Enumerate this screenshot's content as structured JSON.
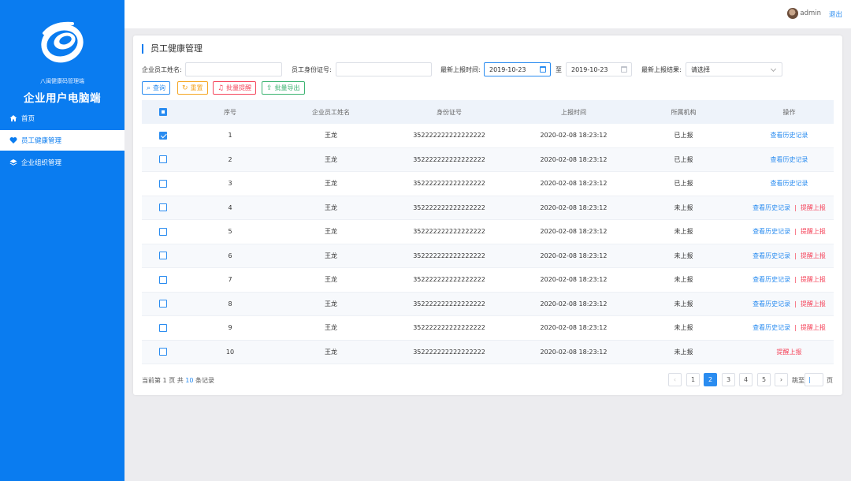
{
  "sidebar": {
    "org_small": "八闽健康码管理端",
    "org_title": "企业用户电脑端",
    "items": [
      {
        "label": "首页",
        "icon": "home-icon"
      },
      {
        "label": "员工健康管理",
        "icon": "heart-icon"
      },
      {
        "label": "企业组织管理",
        "icon": "layers-icon"
      }
    ],
    "active_index": 1
  },
  "topbar": {
    "user": "admin",
    "logout": "退出"
  },
  "page": {
    "title": "员工健康管理"
  },
  "filters": {
    "name_label": "企业员工姓名:",
    "name_value": "",
    "id_label": "员工身份证号:",
    "id_value": "",
    "date_label": "最新上报时间:",
    "date_from": "2019-10-23",
    "date_to_sep": "至",
    "date_to": "2019-10-23",
    "result_label": "最新上报结果:",
    "result_value": "请选择"
  },
  "actions": {
    "search": "查询",
    "reset": "重置",
    "batch_remind": "批量提醒",
    "batch_export": "批量导出"
  },
  "colors": {
    "primary": "#0a7cf0",
    "link": "#2a8cf0",
    "danger": "#f5455b",
    "reset": "#f5a623",
    "export": "#3cb371"
  },
  "table": {
    "columns": [
      "序号",
      "企业员工姓名",
      "身份证号",
      "上报时间",
      "所属机构",
      "操作"
    ],
    "header_checkbox_state": "indeterminate",
    "rows": [
      {
        "no": "1",
        "name": "王龙",
        "id": "352222222222222222",
        "time": "2020-02-08 18:23:12",
        "status": "已上报",
        "checked": true,
        "history": "查看历史记录",
        "remind": ""
      },
      {
        "no": "2",
        "name": "王龙",
        "id": "352222222222222222",
        "time": "2020-02-08 18:23:12",
        "status": "已上报",
        "checked": false,
        "history": "查看历史记录",
        "remind": ""
      },
      {
        "no": "3",
        "name": "王龙",
        "id": "352222222222222222",
        "time": "2020-02-08 18:23:12",
        "status": "已上报",
        "checked": false,
        "history": "查看历史记录",
        "remind": ""
      },
      {
        "no": "4",
        "name": "王龙",
        "id": "352222222222222222",
        "time": "2020-02-08 18:23:12",
        "status": "未上报",
        "checked": false,
        "history": "查看历史记录",
        "remind": "提醒上报"
      },
      {
        "no": "5",
        "name": "王龙",
        "id": "352222222222222222",
        "time": "2020-02-08 18:23:12",
        "status": "未上报",
        "checked": false,
        "history": "查看历史记录",
        "remind": "提醒上报"
      },
      {
        "no": "6",
        "name": "王龙",
        "id": "352222222222222222",
        "time": "2020-02-08 18:23:12",
        "status": "未上报",
        "checked": false,
        "history": "查看历史记录",
        "remind": "提醒上报"
      },
      {
        "no": "7",
        "name": "王龙",
        "id": "352222222222222222",
        "time": "2020-02-08 18:23:12",
        "status": "未上报",
        "checked": false,
        "history": "查看历史记录",
        "remind": "提醒上报"
      },
      {
        "no": "8",
        "name": "王龙",
        "id": "352222222222222222",
        "time": "2020-02-08 18:23:12",
        "status": "未上报",
        "checked": false,
        "history": "查看历史记录",
        "remind": "提醒上报"
      },
      {
        "no": "9",
        "name": "王龙",
        "id": "352222222222222222",
        "time": "2020-02-08 18:23:12",
        "status": "未上报",
        "checked": false,
        "history": "查看历史记录",
        "remind": "提醒上报"
      },
      {
        "no": "10",
        "name": "王龙",
        "id": "352222222222222222",
        "time": "2020-02-08 18:23:12",
        "status": "未上报",
        "checked": false,
        "history": "",
        "remind": "提醒上报"
      }
    ]
  },
  "footer": {
    "page_prefix": "当前第",
    "current_page": "1",
    "page_mid": "页 共",
    "total": "10",
    "total_suffix": "条记录",
    "pages": [
      "1",
      "2",
      "3",
      "4",
      "5"
    ],
    "active_page": "2",
    "goto_label": "跳至",
    "goto_suffix": "页"
  }
}
